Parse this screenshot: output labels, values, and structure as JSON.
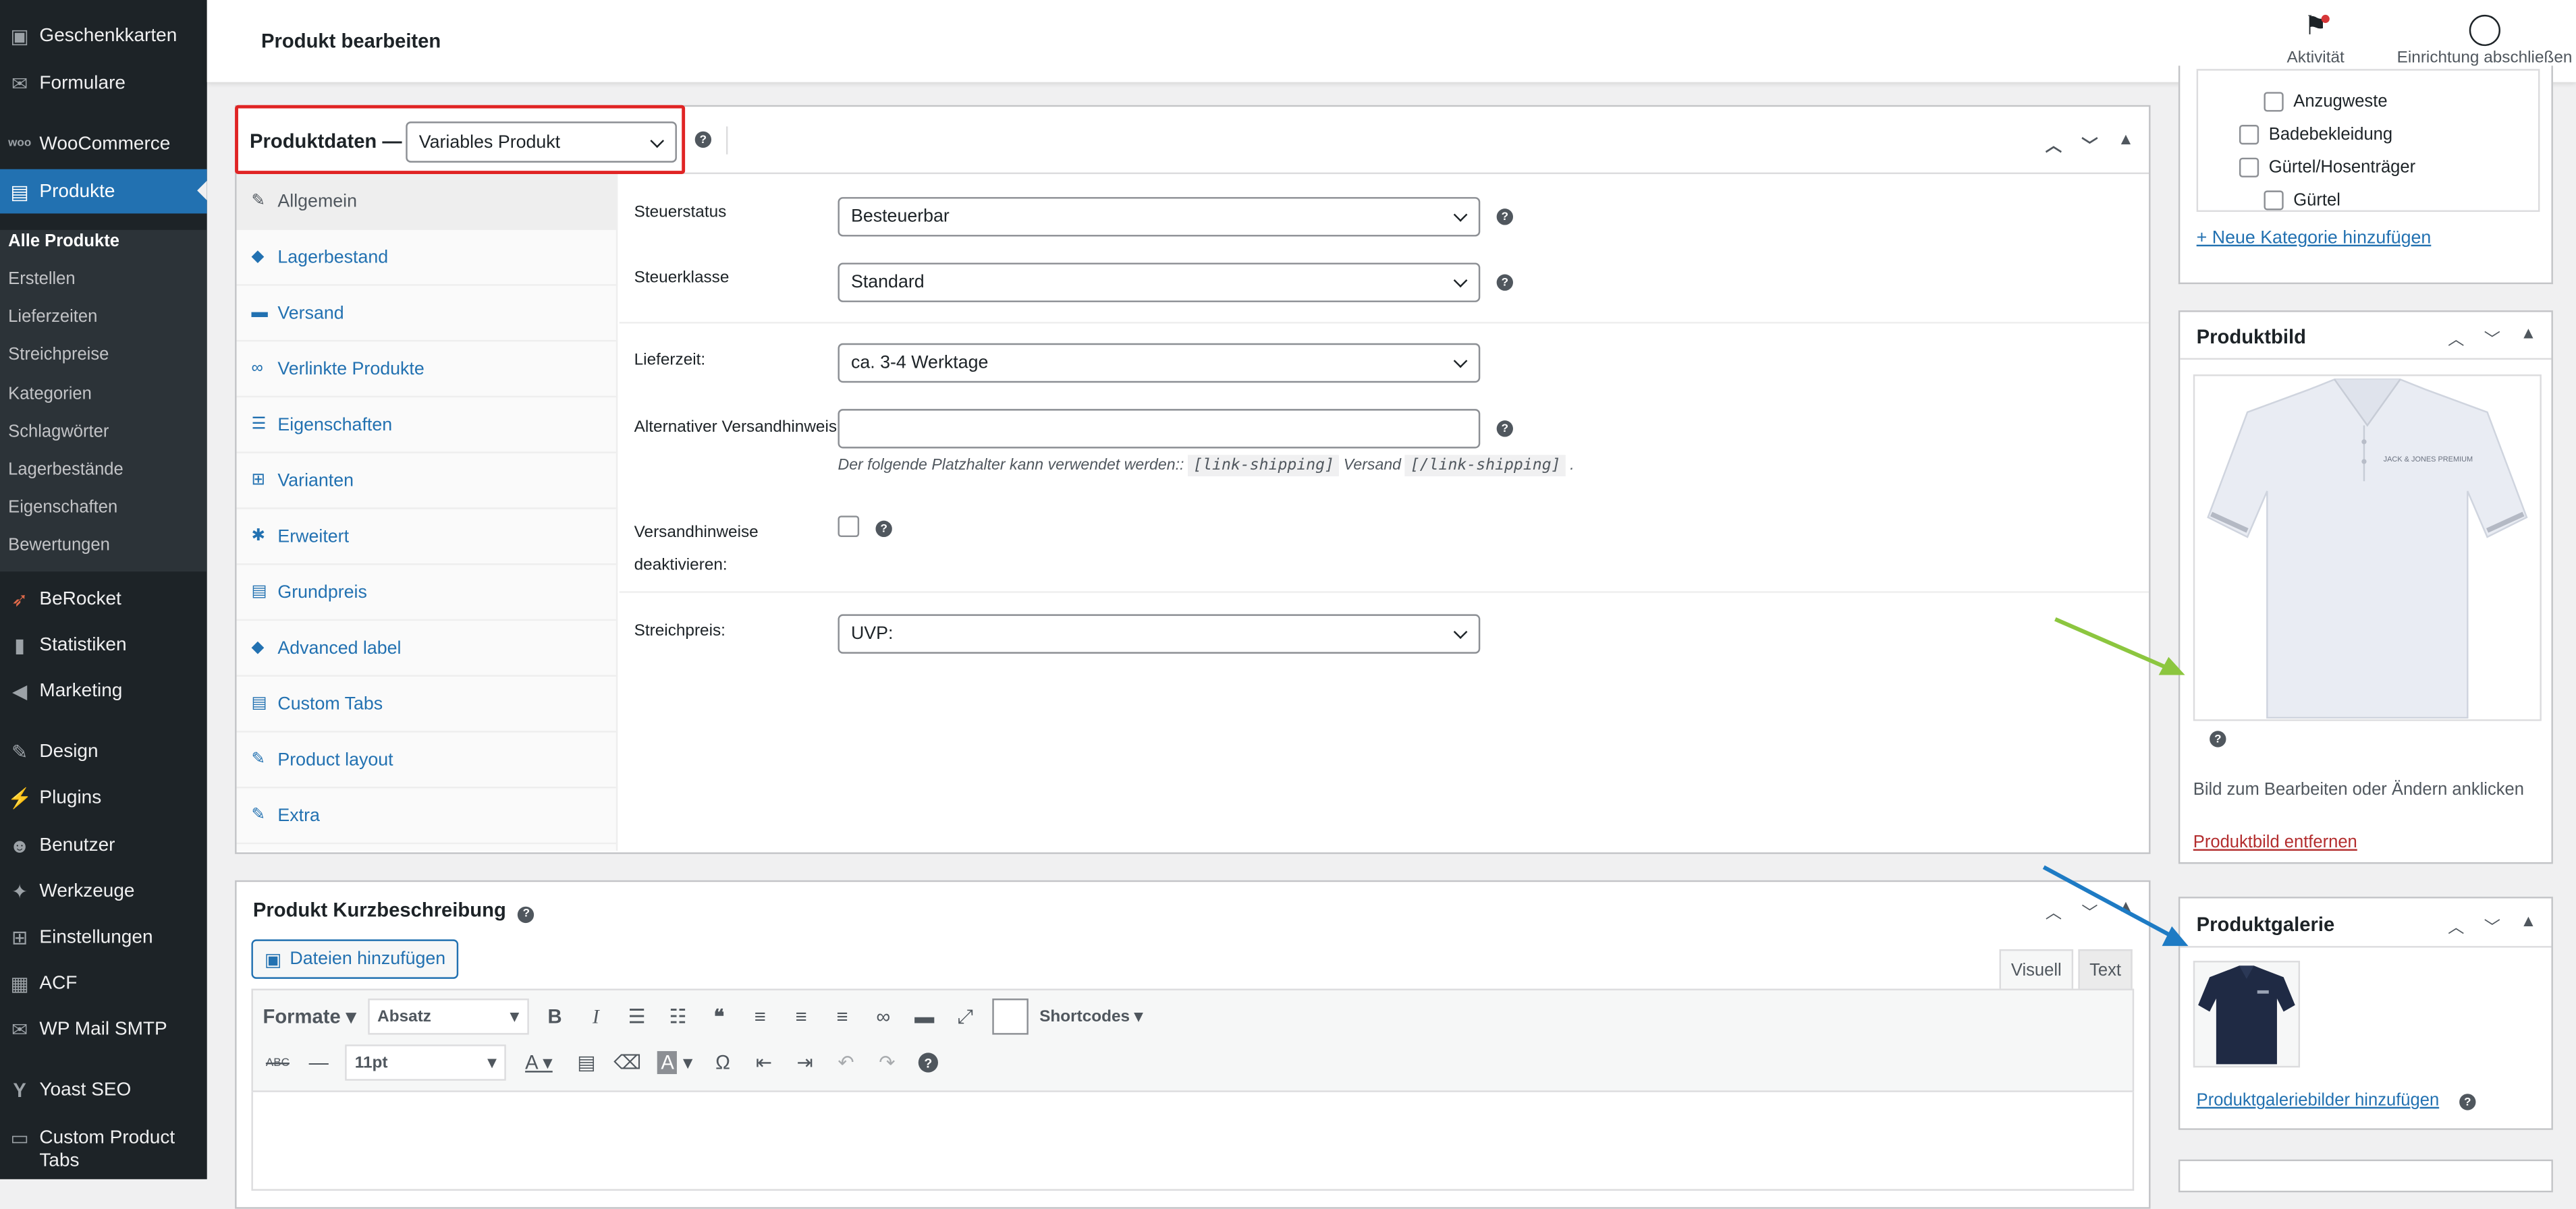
{
  "sidebar": {
    "items": [
      {
        "label": "Geschenkkarten",
        "icon": "gift-card-icon"
      },
      {
        "label": "Formulare",
        "icon": "mail-icon"
      },
      {
        "label": "WooCommerce",
        "icon": "woo-icon"
      },
      {
        "label": "Produkte",
        "icon": "archive-icon"
      },
      {
        "label": "BeRocket",
        "icon": "rocket-icon"
      },
      {
        "label": "Statistiken",
        "icon": "bar-chart-icon"
      },
      {
        "label": "Marketing",
        "icon": "megaphone-icon"
      },
      {
        "label": "Design",
        "icon": "brush-icon"
      },
      {
        "label": "Plugins",
        "icon": "plug-icon"
      },
      {
        "label": "Benutzer",
        "icon": "user-icon"
      },
      {
        "label": "Werkzeuge",
        "icon": "wrench-icon"
      },
      {
        "label": "Einstellungen",
        "icon": "settings-icon"
      },
      {
        "label": "ACF",
        "icon": "acf-icon"
      },
      {
        "label": "WP Mail SMTP",
        "icon": "envelope-icon"
      },
      {
        "label": "Yoast SEO",
        "icon": "yoast-icon"
      },
      {
        "label": "Custom Product Tabs",
        "icon": "tabs-icon"
      }
    ],
    "submenu": [
      "Alle Produkte",
      "Erstellen",
      "Lieferzeiten",
      "Streichpreise",
      "Kategorien",
      "Schlagwörter",
      "Lagerbestände",
      "Eigenschaften",
      "Bewertungen"
    ]
  },
  "topbar": {
    "title": "Produkt bearbeiten",
    "activity": "Aktivität",
    "setup": "Einrichtung abschließen"
  },
  "product_data": {
    "title": "Produktdaten —",
    "type": "Variables Produkt",
    "tabs": [
      "Allgemein",
      "Lagerbestand",
      "Versand",
      "Verlinkte Produkte",
      "Eigenschaften",
      "Varianten",
      "Erweitert",
      "Grundpreis",
      "Advanced label",
      "Custom Tabs",
      "Product layout",
      "Extra"
    ],
    "fields": {
      "tax_status_label": "Steuerstatus",
      "tax_status": "Besteuerbar",
      "tax_class_label": "Steuerklasse",
      "tax_class": "Standard",
      "delivery_label": "Lieferzeit:",
      "delivery": "ca. 3-4 Werktage",
      "alt_shipping_label": "Alternativer Versandhinweis:",
      "alt_shipping_value": "",
      "hint_prefix": "Der folgende Platzhalter kann verwendet werden::",
      "hint_code1": "[link-shipping]",
      "hint_mid": "Versand",
      "hint_code2": "[/link-shipping]",
      "hint_end": ".",
      "disable_label_1": "Versandhinweise",
      "disable_label_2": "deaktivieren:",
      "strike_label": "Streichpreis:",
      "strike": "UVP:"
    }
  },
  "short_desc": {
    "title": "Produkt Kurzbeschreibung",
    "add_media": "Dateien hinzufügen",
    "tab_visual": "Visuell",
    "tab_text": "Text",
    "formats": "Formate",
    "paragraph": "Absatz",
    "shortcodes": "Shortcodes",
    "fontsize": "11pt"
  },
  "categories": {
    "items": [
      "Anzugweste",
      "Badebekleidung",
      "Gürtel/Hosenträger",
      "Gürtel"
    ],
    "add_link": "+ Neue Kategorie hinzufügen"
  },
  "product_image": {
    "title": "Produktbild",
    "hint": "Bild zum Bearbeiten oder Ändern anklicken",
    "remove": "Produktbild entfernen",
    "shirt_print": "JACK & JONES PREMIUM"
  },
  "gallery": {
    "title": "Produktgalerie",
    "add_link": "Produktgaleriebilder hinzufügen"
  },
  "colors": {
    "sidebar": "#1d2327",
    "accent": "#2271b1",
    "highlight": "#e02424",
    "arrow_green": "#8cc63f",
    "arrow_blue": "#1e7bc4"
  }
}
